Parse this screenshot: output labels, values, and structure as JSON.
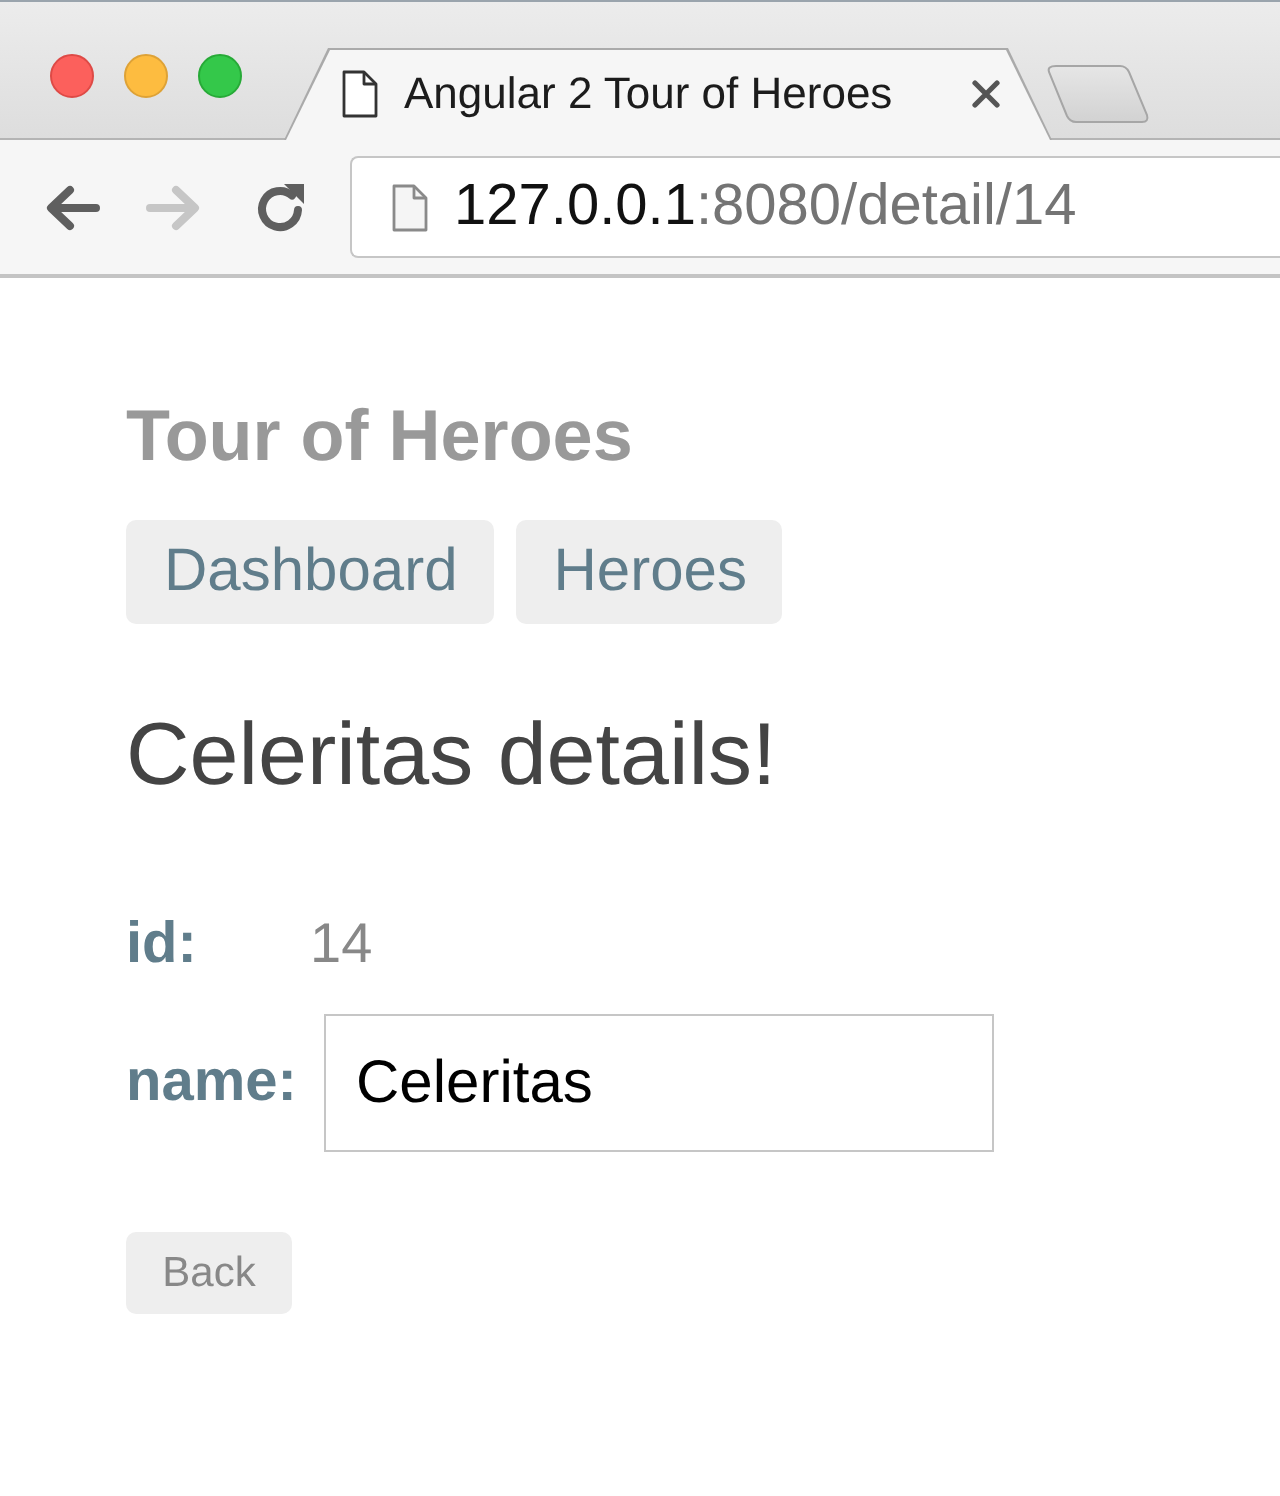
{
  "window": {
    "tabs": [
      {
        "title": "Angular 2 Tour of Heroes",
        "selected": true
      }
    ],
    "toolbar_buttons": [
      {
        "kind": "back",
        "disabled": false
      },
      {
        "kind": "forward",
        "disabled": true
      },
      {
        "kind": "reload",
        "disabled": false
      }
    ],
    "address_bar": {
      "host": "127.0.0.1",
      "path": ":8080/detail/14"
    }
  },
  "page": {
    "title": "Tour of Heroes",
    "nav": [
      {
        "label": "Dashboard"
      },
      {
        "label": "Heroes"
      }
    ],
    "heading": "Celeritas details!",
    "fields": [
      {
        "kind": "text",
        "label": "id:",
        "value": "14"
      },
      {
        "kind": "input",
        "label": "name:",
        "value": "Celeritas"
      }
    ],
    "back_button": "Back"
  }
}
